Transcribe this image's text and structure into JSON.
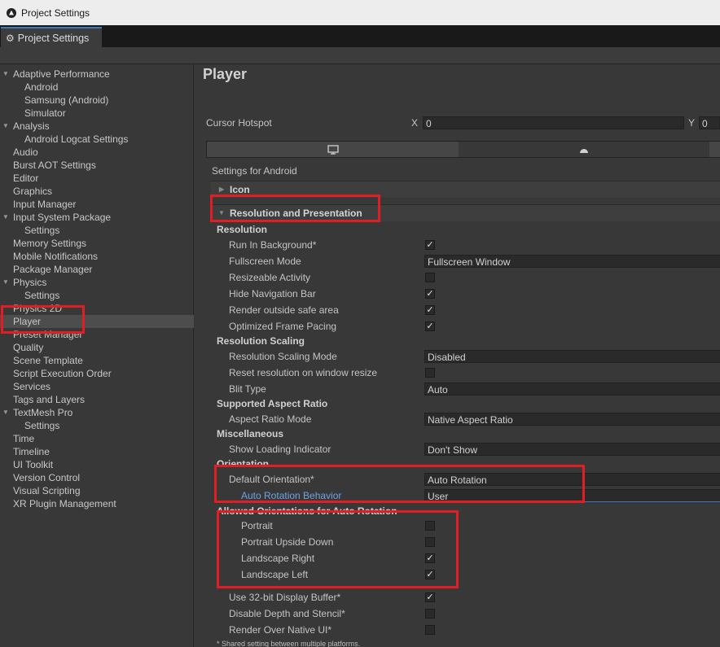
{
  "window": {
    "title": "Project Settings"
  },
  "tab": {
    "label": "Project Settings"
  },
  "sidebar": {
    "items": [
      {
        "label": "Adaptive Performance",
        "indent": 0,
        "arrow": true
      },
      {
        "label": "Android",
        "indent": 1
      },
      {
        "label": "Samsung (Android)",
        "indent": 1
      },
      {
        "label": "Simulator",
        "indent": 1
      },
      {
        "label": "Analysis",
        "indent": 0,
        "arrow": true
      },
      {
        "label": "Android Logcat Settings",
        "indent": 1
      },
      {
        "label": "Audio",
        "indent": 0
      },
      {
        "label": "Burst AOT Settings",
        "indent": 0
      },
      {
        "label": "Editor",
        "indent": 0
      },
      {
        "label": "Graphics",
        "indent": 0
      },
      {
        "label": "Input Manager",
        "indent": 0
      },
      {
        "label": "Input System Package",
        "indent": 0,
        "arrow": true
      },
      {
        "label": "Settings",
        "indent": 1
      },
      {
        "label": "Memory Settings",
        "indent": 0
      },
      {
        "label": "Mobile Notifications",
        "indent": 0
      },
      {
        "label": "Package Manager",
        "indent": 0
      },
      {
        "label": "Physics",
        "indent": 0,
        "arrow": true
      },
      {
        "label": "Settings",
        "indent": 1
      },
      {
        "label": "Physics 2D",
        "indent": 0
      },
      {
        "label": "Player",
        "indent": 0,
        "selected": true
      },
      {
        "label": "Preset Manager",
        "indent": 0
      },
      {
        "label": "Quality",
        "indent": 0
      },
      {
        "label": "Scene Template",
        "indent": 0
      },
      {
        "label": "Script Execution Order",
        "indent": 0
      },
      {
        "label": "Services",
        "indent": 0
      },
      {
        "label": "Tags and Layers",
        "indent": 0
      },
      {
        "label": "TextMesh Pro",
        "indent": 0,
        "arrow": true
      },
      {
        "label": "Settings",
        "indent": 1
      },
      {
        "label": "Time",
        "indent": 0
      },
      {
        "label": "Timeline",
        "indent": 0
      },
      {
        "label": "UI Toolkit",
        "indent": 0
      },
      {
        "label": "Version Control",
        "indent": 0
      },
      {
        "label": "Visual Scripting",
        "indent": 0
      },
      {
        "label": "XR Plugin Management",
        "indent": 0
      }
    ]
  },
  "main": {
    "title": "Player",
    "cursor_hotspot": {
      "label": "Cursor Hotspot",
      "x_label": "X",
      "x_value": "0",
      "y_label": "Y",
      "y_value": "0"
    },
    "settings_for": "Settings for Android",
    "icon_section": "Icon",
    "resolution_section": "Resolution and Presentation",
    "resolution_heading": "Resolution",
    "run_in_background": "Run In Background*",
    "fullscreen_mode": {
      "label": "Fullscreen Mode",
      "value": "Fullscreen Window"
    },
    "resizeable_activity": "Resizeable Activity",
    "hide_navigation_bar": "Hide Navigation Bar",
    "render_outside_safe_area": "Render outside safe area",
    "optimized_frame_pacing": "Optimized Frame Pacing",
    "resolution_scaling_heading": "Resolution Scaling",
    "resolution_scaling_mode": {
      "label": "Resolution Scaling Mode",
      "value": "Disabled"
    },
    "reset_resolution": "Reset resolution on window resize",
    "blit_type": {
      "label": "Blit Type",
      "value": "Auto"
    },
    "aspect_heading": "Supported Aspect Ratio",
    "aspect_ratio_mode": {
      "label": "Aspect Ratio Mode",
      "value": "Native Aspect Ratio"
    },
    "misc_heading": "Miscellaneous",
    "show_loading_indicator": {
      "label": "Show Loading Indicator",
      "value": "Don't Show"
    },
    "orientation_heading": "Orientation",
    "default_orientation": {
      "label": "Default Orientation*",
      "value": "Auto Rotation"
    },
    "auto_rotation_behavior": {
      "label": "Auto Rotation Behavior",
      "value": "User"
    },
    "allowed_heading": "Allowed Orientations for Auto Rotation",
    "portrait": "Portrait",
    "portrait_upside_down": "Portrait Upside Down",
    "landscape_right": "Landscape Right",
    "landscape_left": "Landscape Left",
    "use_32bit": "Use 32-bit Display Buffer*",
    "disable_depth": "Disable Depth and Stencil*",
    "render_over_native": "Render Over Native UI*",
    "footnote": "* Shared setting between multiple platforms.",
    "checkmark": "✓"
  },
  "colors": {
    "accent": "#3a79bb",
    "highlight": "#e01e24",
    "link": "#6ea2e3"
  }
}
